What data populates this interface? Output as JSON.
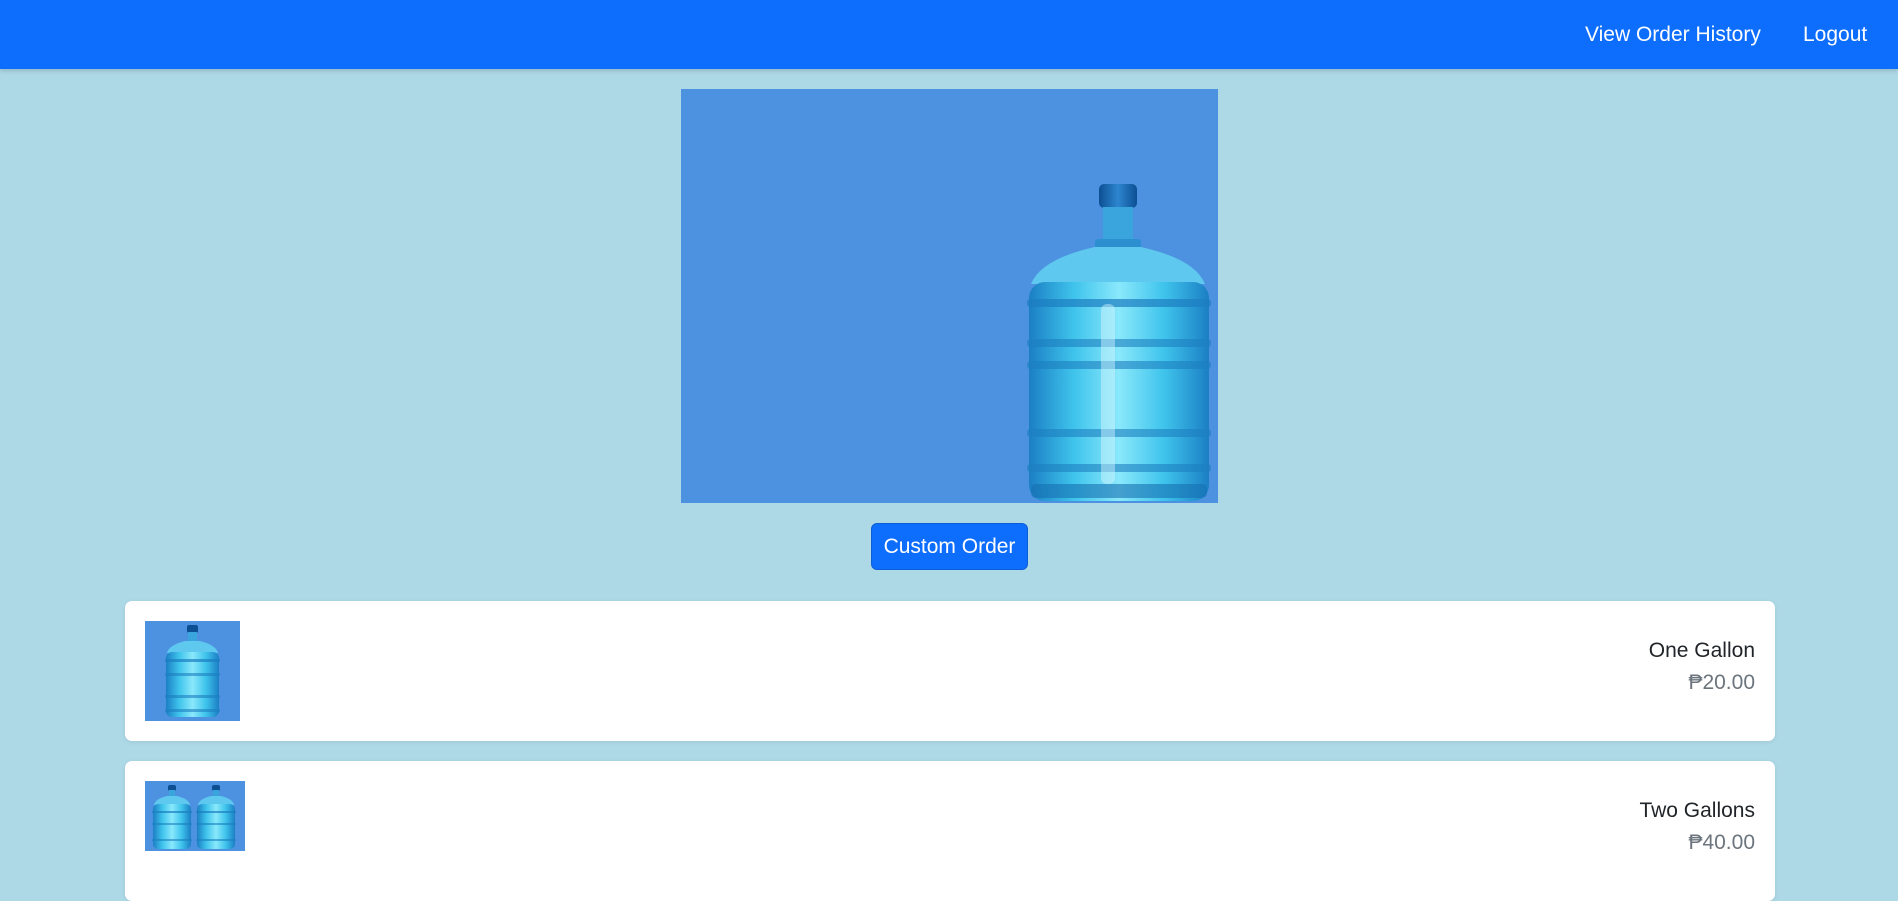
{
  "navbar": {
    "links": {
      "order_history": "View Order History",
      "logout": "Logout"
    },
    "color": "#0d6efd"
  },
  "hero": {
    "image": "water-gallon-icon",
    "background": "#4d92e1"
  },
  "actions": {
    "custom_order_label": "Custom Order"
  },
  "products": [
    {
      "name": "One Gallon",
      "price": "₱20.00",
      "image": "water-gallon-icon",
      "quantity_shown": 1
    },
    {
      "name": "Two Gallons",
      "price": "₱40.00",
      "image": "water-gallon-icon",
      "quantity_shown": 2
    }
  ],
  "colors": {
    "page_background": "#add8e6",
    "card_background": "#ffffff",
    "price_text": "#6c757d",
    "primary": "#0d6efd"
  }
}
